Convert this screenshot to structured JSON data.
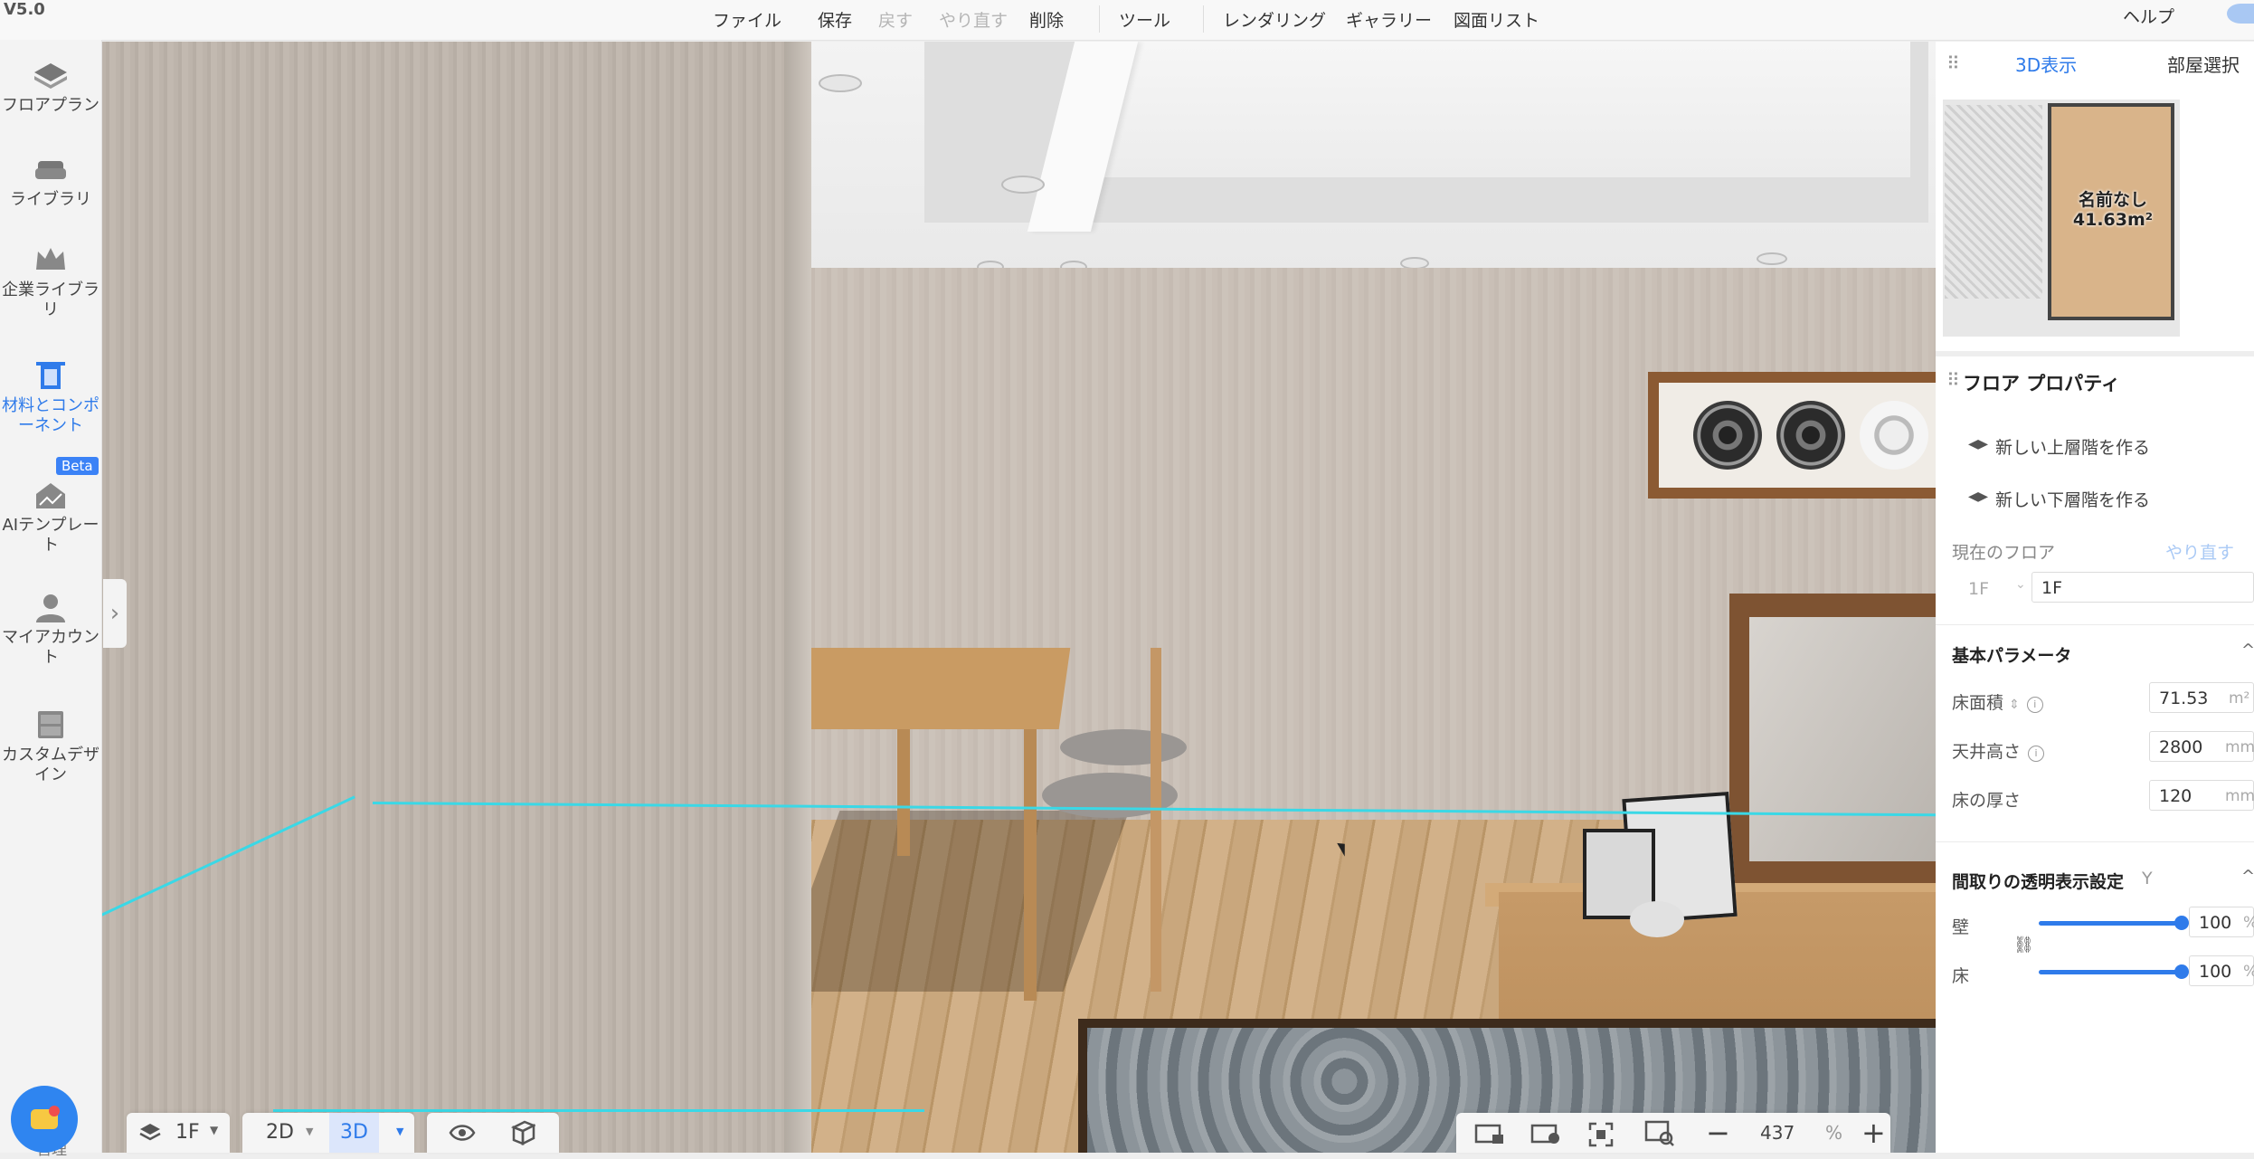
{
  "app": {
    "version": "V5.0"
  },
  "menubar": {
    "file": "ファイル",
    "save": "保存",
    "undo": "戻す",
    "redo": "やり直す",
    "delete": "削除",
    "tools": "ツール",
    "rendering": "レンダリング",
    "gallery": "ギャラリー",
    "drawing_list": "図面リスト",
    "help": "ヘルプ"
  },
  "sidebar": {
    "items": [
      {
        "label": "フロアプラン"
      },
      {
        "label": "ライブラリ"
      },
      {
        "label": "企業ライブラリ"
      },
      {
        "label": "材料とコンポーネント"
      },
      {
        "label": "AIテンプレート"
      },
      {
        "label": "マイアカウント"
      },
      {
        "label": "カスタムデザイン"
      }
    ],
    "beta_badge": "Beta",
    "bottom_label": "管理"
  },
  "minimap": {
    "tab_3d": "3D表示",
    "tab_room_select": "部屋選択",
    "room_name": "名前なし",
    "room_area": "41.63m²"
  },
  "floor_properties": {
    "title": "フロア プロパティ",
    "new_upper": "新しい上層階を作る",
    "new_lower": "新しい下層階を作る",
    "current_floor_label": "現在のフロア",
    "redo_link": "やり直す",
    "floor_select": "1F",
    "floor_name": "1F",
    "basic_params_title": "基本パラメータ",
    "floor_area_label": "床面積",
    "floor_area_value": "71.53",
    "floor_area_unit": "m²",
    "ceiling_height_label": "天井高さ",
    "ceiling_height_value": "2800",
    "ceiling_height_unit": "mm",
    "floor_thickness_label": "床の厚さ",
    "floor_thickness_value": "120",
    "floor_thickness_unit": "mm",
    "transparency_title": "間取りの透明表示設定",
    "transparency_shortcut": "Y",
    "wall_label": "壁",
    "wall_value": "100",
    "floor_label": "床",
    "floor_value": "100",
    "percent": "%"
  },
  "bottombar": {
    "floor": "1F",
    "view_2d": "2D",
    "view_3d": "3D",
    "zoom": "437",
    "zoom_unit": "%"
  },
  "colors": {
    "accent": "#2f7bea",
    "cyan_outline": "#3ad8e6"
  }
}
